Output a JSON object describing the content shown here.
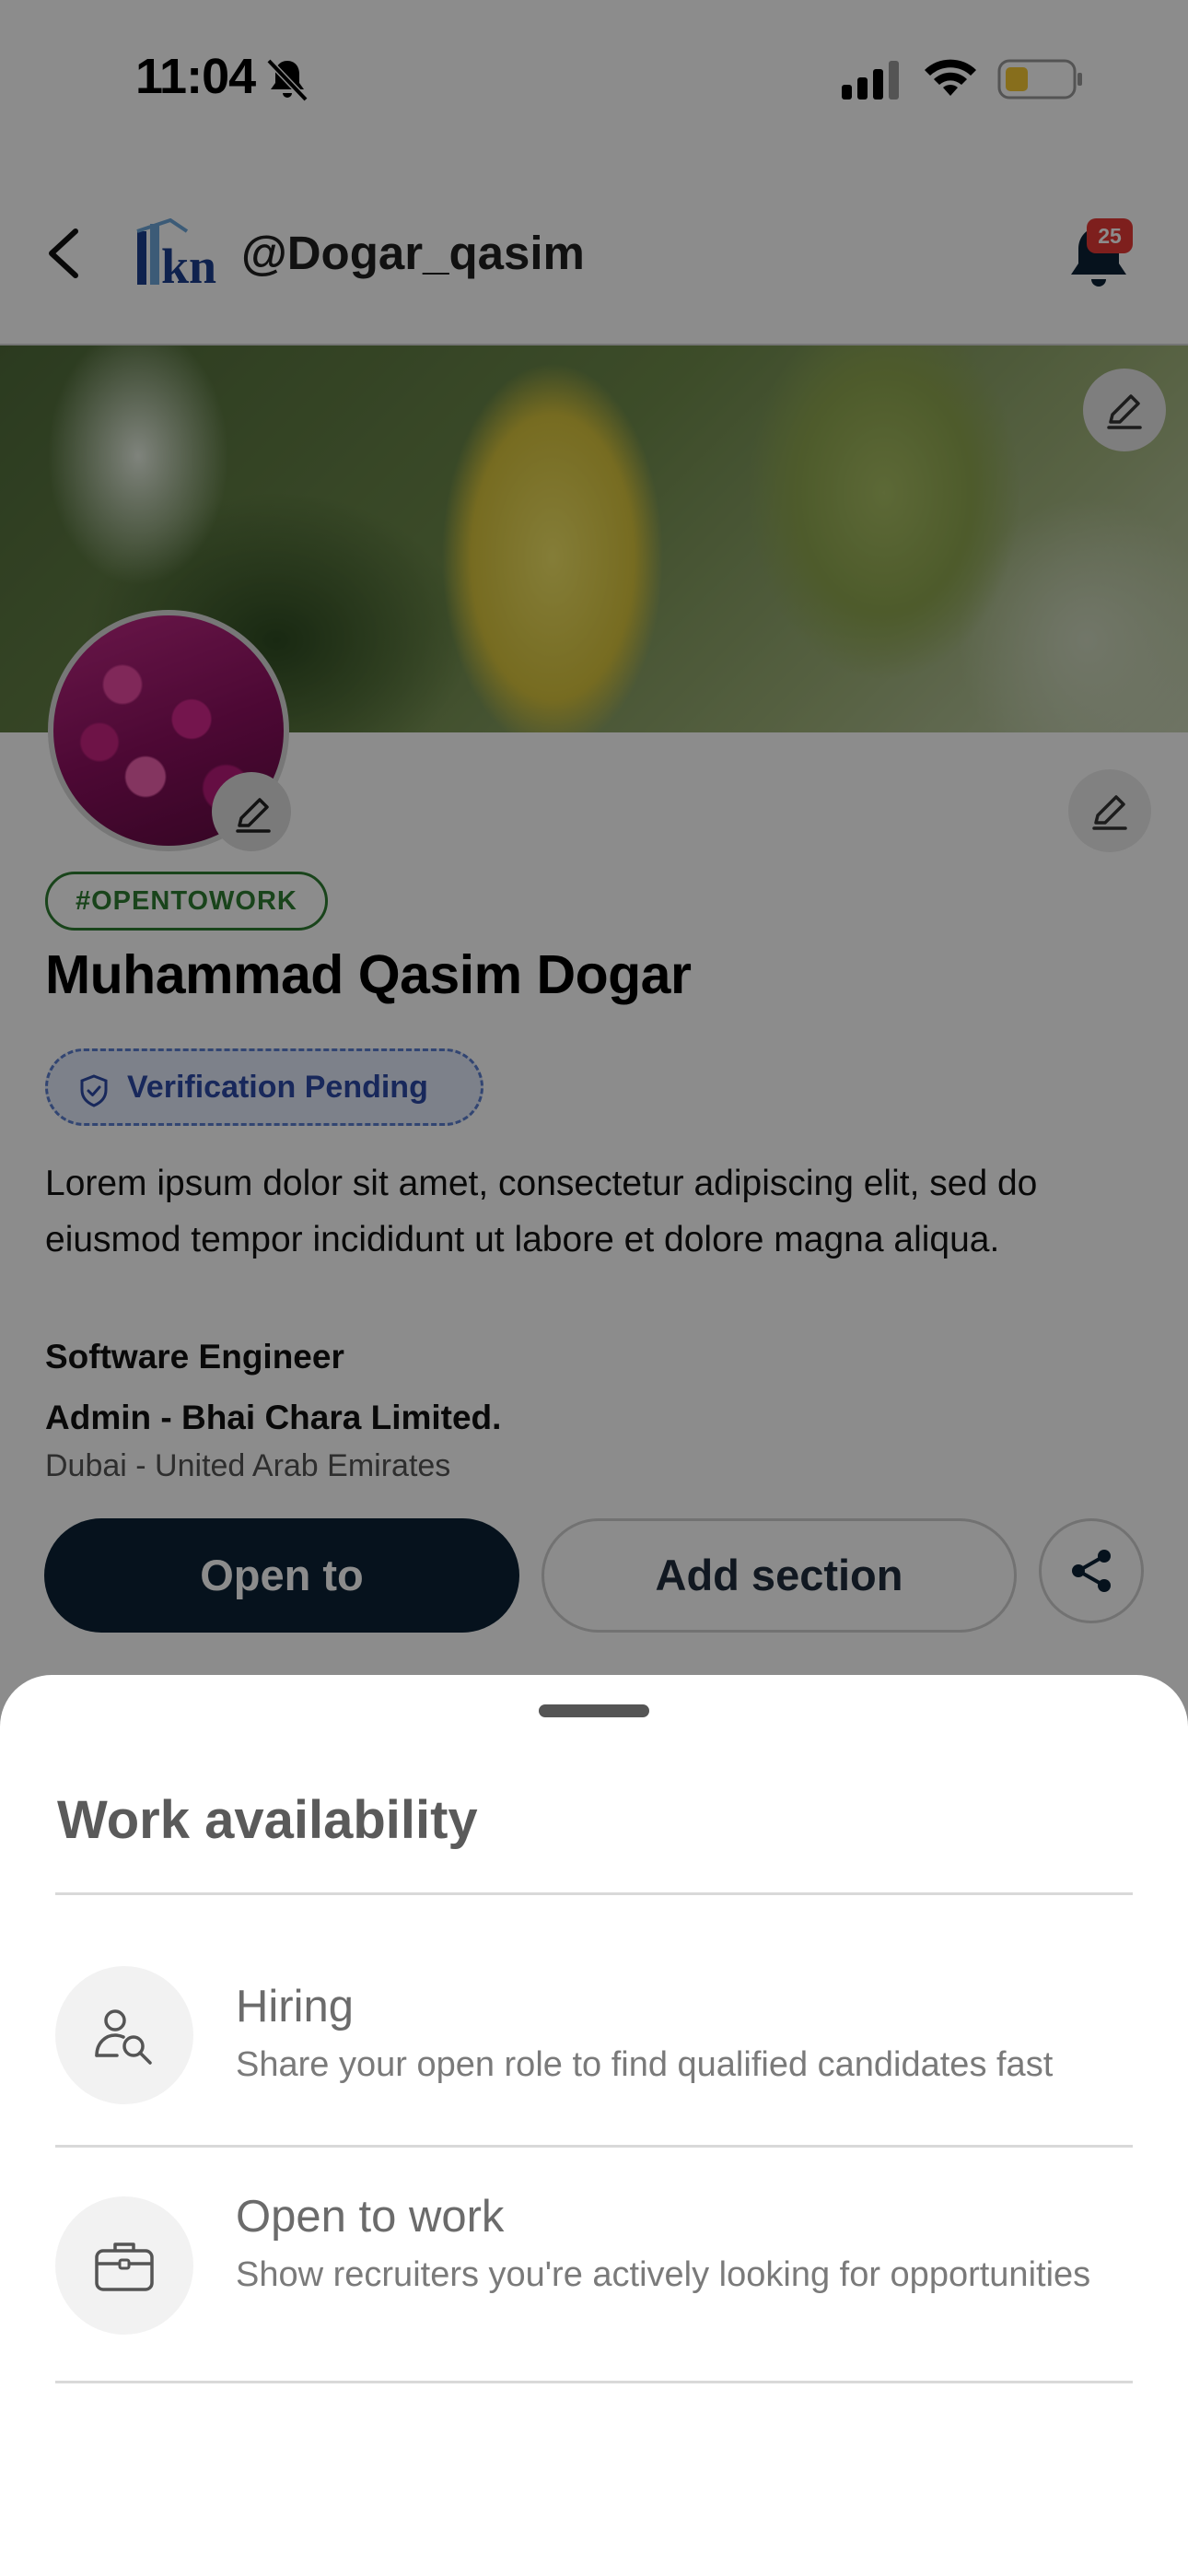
{
  "status_bar": {
    "time": "11:04",
    "icons": [
      "bell-slash-icon",
      "cellular-signal-icon",
      "wifi-icon",
      "battery-low-icon"
    ]
  },
  "header": {
    "logo_text": "Rkn",
    "handle": "@Dogar_qasim",
    "notification_count": "25"
  },
  "profile": {
    "badge": "#OPENTOWORK",
    "name": "Muhammad Qasim Dogar",
    "verification": "Verification Pending",
    "bio": "Lorem ipsum dolor sit amet, consectetur adipiscing elit, sed do eiusmod tempor incididunt ut labore et dolore magna aliqua.",
    "role": "Software Engineer",
    "company": "Admin - Bhai Chara Limited.",
    "location": "Dubai - United Arab Emirates"
  },
  "actions": {
    "open_to": "Open to",
    "add_section": "Add section"
  },
  "sheet": {
    "title": "Work availability",
    "options": [
      {
        "title": "Hiring",
        "subtitle": "Share your open role to find qualified candidates fast",
        "icon": "person-search-icon"
      },
      {
        "title": "Open to work",
        "subtitle": "Show recruiters you're actively looking for opportunities",
        "icon": "briefcase-icon"
      }
    ]
  },
  "colors": {
    "primary_button": "#0c2236",
    "open_to_work_green": "#2e7d32",
    "verification_blue": "#2d4aa6",
    "notification_red": "#e53935"
  }
}
